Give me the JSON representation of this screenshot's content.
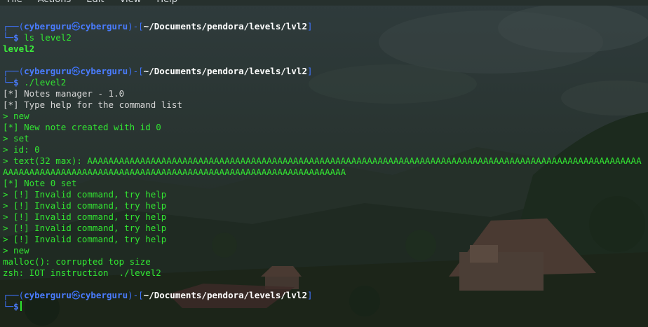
{
  "menu": [
    "File",
    "Actions",
    "Edit",
    "View",
    "Help"
  ],
  "prompt": {
    "user": "cyberguru",
    "at_symbol": "㉿",
    "host": "cyberguru",
    "path": "~/Documents/pendora/levels/lvl2",
    "top_prefix": "┌──(",
    "sep": ")-[",
    "close": "]",
    "bottom_prefix": "└─",
    "dollar": "$"
  },
  "commands": {
    "c1": "ls level2",
    "c2": "./level2"
  },
  "output": {
    "ls_result": "level2",
    "lines": [
      "[*] Notes manager - 1.0",
      "[*] Type help for the command list",
      "> new",
      "[*] New note created with id 0",
      "> set",
      "> id: 0",
      "> text(32 max): AAAAAAAAAAAAAAAAAAAAAAAAAAAAAAAAAAAAAAAAAAAAAAAAAAAAAAAAAAAAAAAAAAAAAAAAAAAAAAAAAAAAAAAAAAAAAAAAAAAAAAAAA",
      "AAAAAAAAAAAAAAAAAAAAAAAAAAAAAAAAAAAAAAAAAAAAAAAAAAAAAAAAAAAAAAAAA",
      "[*] Note 0 set",
      "> [!] Invalid command, try help",
      "> [!] Invalid command, try help",
      "> [!] Invalid command, try help",
      "> [!] Invalid command, try help",
      "> [!] Invalid command, try help",
      "> new",
      "malloc(): corrupted top size",
      "zsh: IOT instruction  ./level2"
    ]
  },
  "colors": {
    "prompt_blue": "#3f74ff",
    "path_green": "#3cf03c",
    "text": "#e6e6e6",
    "background": "#1b2422"
  }
}
